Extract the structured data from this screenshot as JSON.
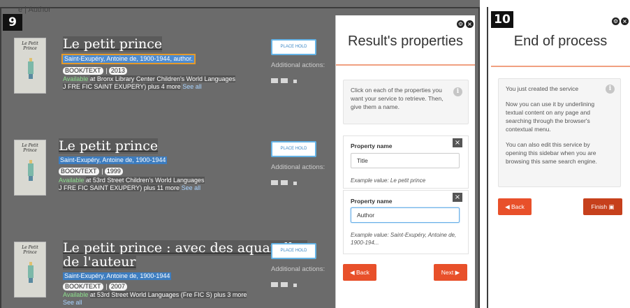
{
  "panel9": {
    "number": "9",
    "header_text": "e | Author",
    "results": [
      {
        "cover_title": "Le Petit Prince",
        "title": "Le petit prince",
        "author": "Saint-Exupéry, Antoine de, 1900-1944, author.",
        "format": "BOOK/TEXT",
        "year": "2013",
        "availability_label": "Available",
        "availability_text": "at Bronx Library Center Children's World Languages",
        "call_number": "J FRE FIC SAINT EXUPERY) plus 4 more",
        "see_all": "See all",
        "place_hold": "PLACE HOLD",
        "additional_actions": "Additional actions:"
      },
      {
        "cover_title": "Le Petit Prince",
        "title": "Le petit prince",
        "author": "Saint-Exupéry, Antoine de, 1900-1944",
        "format": "BOOK/TEXT",
        "year": "1999",
        "availability_label": "Available",
        "availability_text": "at 53rd Street Children's World Languages",
        "call_number": "J FRE FIC SAINT EXUPERY) plus 11 more",
        "see_all": "See all",
        "place_hold": "PLACE HOLD",
        "additional_actions": "Additional actions:"
      },
      {
        "cover_title": "Le Petit Prince",
        "title_line1": "Le petit prince : avec des aquarelles",
        "title_line2": "de l'auteur",
        "author": "Saint-Exupéry, Antoine de, 1900-1944",
        "format": "BOOK/TEXT",
        "year": "2007",
        "availability_label": "Available",
        "availability_text": "at 53rd Street World Languages (Fre FIC S) plus 3 more",
        "see_all": "See all",
        "place_hold": "PLACE HOLD",
        "additional_actions": "Additional actions:"
      }
    ],
    "sidebar": {
      "title": "Result's properties",
      "info": "Click on each of the properties you want your service to retrieve. Then, give them a name.",
      "properties": [
        {
          "label": "Property name",
          "value": "Title",
          "example": "Example value: Le petit prince"
        },
        {
          "label": "Property name",
          "value": "Author",
          "example": "Example value: Saint-Exupéry, Antoine de, 1900-194..."
        }
      ],
      "back_label": "Back",
      "next_label": "Next"
    }
  },
  "panel10": {
    "number": "10",
    "sidebar": {
      "title": "End of process",
      "info_lines": [
        "You just created the service",
        "Now you can use it by underlining textual content on any page and searching through the browser's contextual menu.",
        "You can also edit this service by opening this sidebar when you are browsing this same search engine."
      ],
      "back_label": "Back",
      "finish_label": "Finish"
    }
  },
  "colors": {
    "accent_orange": "#e8502a",
    "link_blue": "#3d7dc0",
    "highlight_orange": "#e59a2a",
    "available_green": "#8ee08e"
  },
  "icons": [
    "settings-icon",
    "close-icon",
    "info-icon",
    "email-icon",
    "remove-icon",
    "save-icon"
  ]
}
